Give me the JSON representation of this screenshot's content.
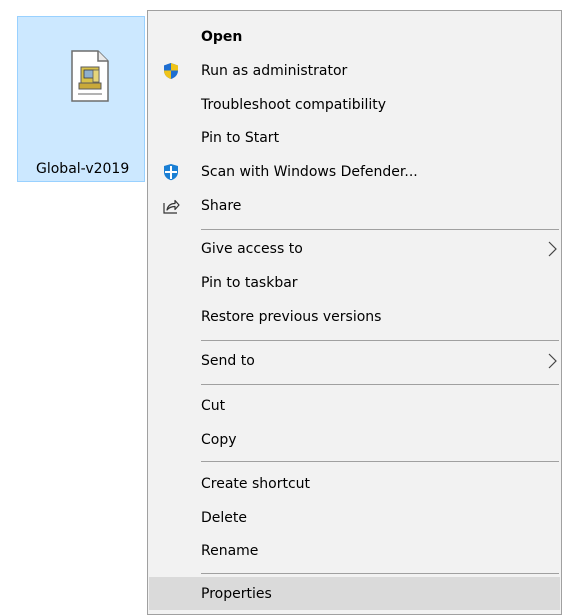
{
  "desktop": {
    "file": {
      "name": "Global-v2019",
      "icon": "setup-file-icon",
      "selected": true
    }
  },
  "context_menu": {
    "items": [
      {
        "label": "Open",
        "default": true
      },
      {
        "label": "Run as administrator",
        "icon": "uac-shield-icon"
      },
      {
        "label": "Troubleshoot compatibility"
      },
      {
        "label": "Pin to Start"
      },
      {
        "label": "Scan with Windows Defender...",
        "icon": "windows-defender-icon"
      },
      {
        "label": "Share",
        "icon": "share-icon"
      },
      {
        "label": "Give access to",
        "submenu": true
      },
      {
        "label": "Pin to taskbar"
      },
      {
        "label": "Restore previous versions"
      },
      {
        "label": "Send to",
        "submenu": true
      },
      {
        "label": "Cut"
      },
      {
        "label": "Copy"
      },
      {
        "label": "Create shortcut"
      },
      {
        "label": "Delete"
      },
      {
        "label": "Rename"
      },
      {
        "label": "Properties",
        "highlighted": true
      }
    ]
  },
  "colors": {
    "menu_background": "#f2f2f2",
    "menu_hover": "#dadada",
    "selection_background": "#cce8ff",
    "selection_border": "#99d1ff",
    "separator": "#a0a0a0"
  }
}
